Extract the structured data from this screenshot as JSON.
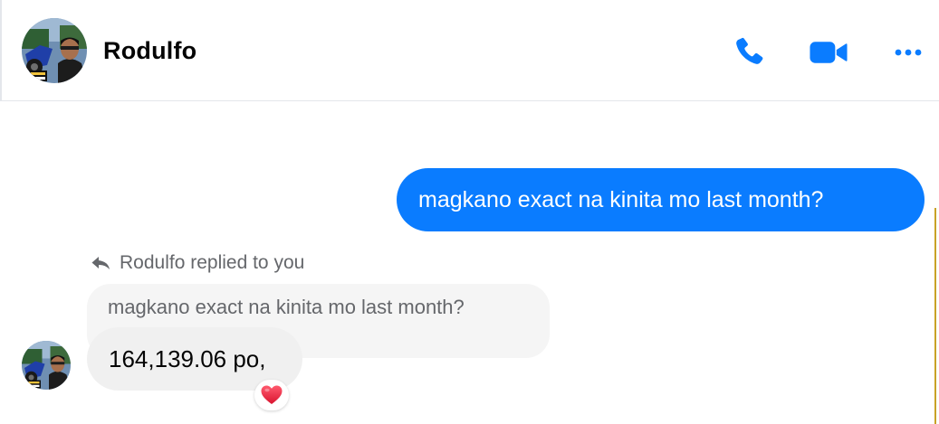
{
  "header": {
    "contact_name": "Rodulfo",
    "avatar_icon": "profile-photo-icon",
    "actions": [
      {
        "name": "voice-call",
        "icon": "phone-icon"
      },
      {
        "name": "video-call",
        "icon": "video-camera-icon"
      },
      {
        "name": "more-options",
        "icon": "more-dots-icon"
      }
    ]
  },
  "messages": {
    "outgoing": {
      "text": "magkano exact na kinita mo last month?"
    },
    "reply": {
      "label": "Rodulfo replied to you",
      "icon": "reply-arrow-icon",
      "quoted_text": "magkano exact na kinita mo last month?",
      "text": "164,139.06 po,",
      "reaction": "❤️",
      "reaction_icon": "heart-reaction-icon"
    }
  },
  "colors": {
    "accent": "#0a7cff",
    "incoming_bubble": "#f0f0f0",
    "quoted_bubble": "#f5f5f5",
    "meta_text": "#65676b",
    "heart": "#e41e3f"
  }
}
